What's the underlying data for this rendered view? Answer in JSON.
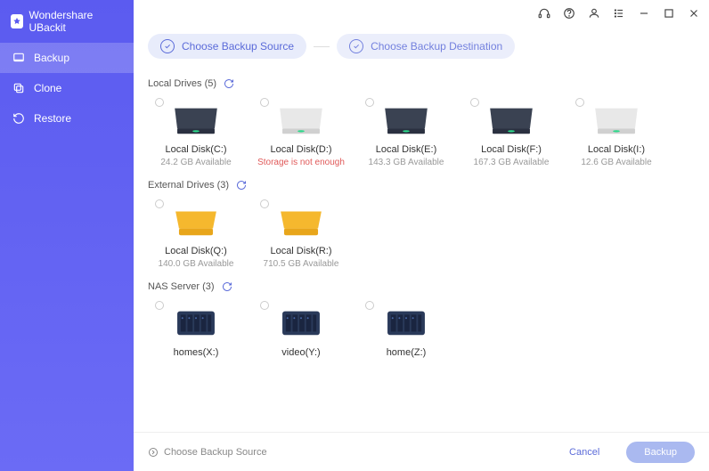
{
  "app": {
    "title": "Wondershare UBackit"
  },
  "nav": {
    "items": [
      {
        "label": "Backup",
        "active": true
      },
      {
        "label": "Clone",
        "active": false
      },
      {
        "label": "Restore",
        "active": false
      }
    ]
  },
  "steps": {
    "source": "Choose Backup Source",
    "destination": "Choose Backup Destination"
  },
  "sections": {
    "local": {
      "title": "Local Drives (5)"
    },
    "external": {
      "title": "External Drives (3)"
    },
    "nas": {
      "title": "NAS Server (3)"
    }
  },
  "drives": {
    "local": [
      {
        "name": "Local Disk(C:)",
        "sub": "24.2 GB Available",
        "error": false,
        "color": "dark"
      },
      {
        "name": "Local Disk(D:)",
        "sub": "Storage is not enough",
        "error": true,
        "color": "light"
      },
      {
        "name": "Local Disk(E:)",
        "sub": "143.3 GB Available",
        "error": false,
        "color": "dark"
      },
      {
        "name": "Local Disk(F:)",
        "sub": "167.3 GB Available",
        "error": false,
        "color": "dark"
      },
      {
        "name": "Local Disk(I:)",
        "sub": "12.6 GB Available",
        "error": false,
        "color": "light"
      }
    ],
    "external": [
      {
        "name": "Local Disk(Q:)",
        "sub": "140.0 GB Available",
        "error": false
      },
      {
        "name": "Local Disk(R:)",
        "sub": "710.5 GB Available",
        "error": false
      }
    ],
    "nas": [
      {
        "name": "homes(X:)"
      },
      {
        "name": "video(Y:)"
      },
      {
        "name": "home(Z:)"
      }
    ]
  },
  "footer": {
    "text": "Choose Backup Source",
    "cancel": "Cancel",
    "backup": "Backup"
  }
}
